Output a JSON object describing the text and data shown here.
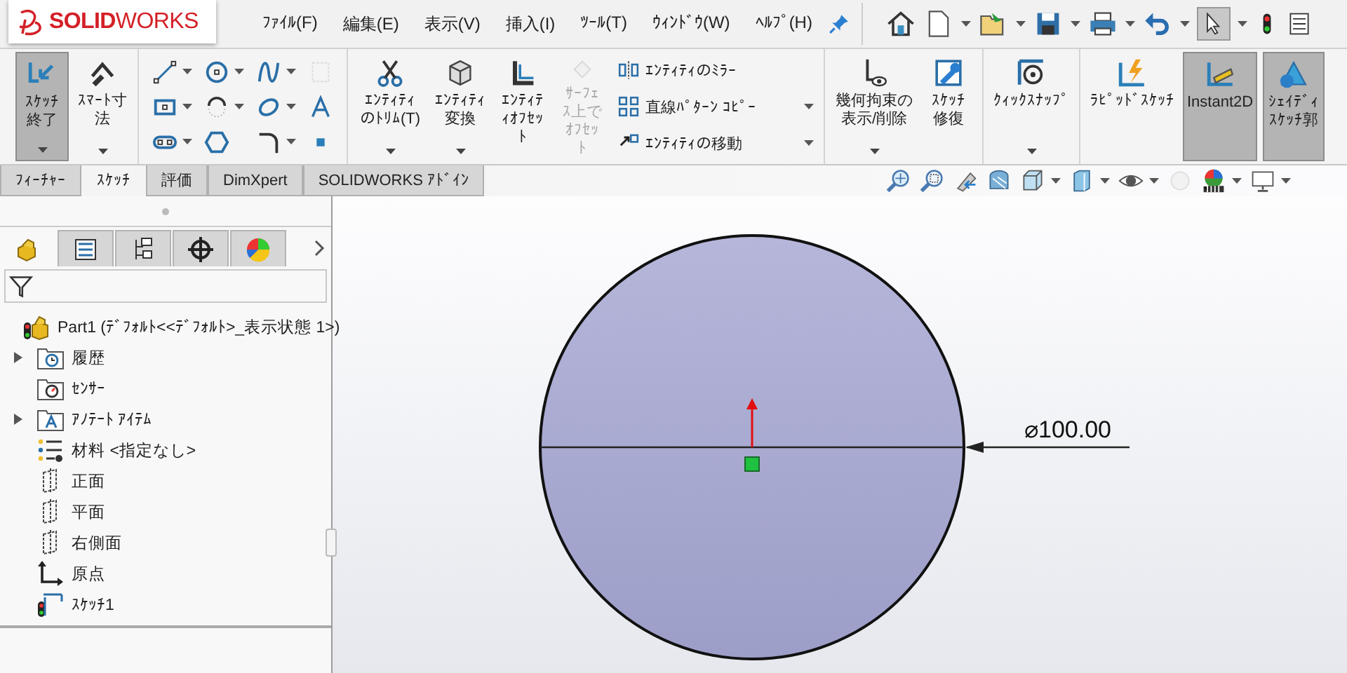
{
  "title_bar": {
    "logo": "**SOLID**WORKS"
  },
  "menu": [
    {
      "label": "ﾌｧｲﾙ(F)"
    },
    {
      "label": "編集(E)"
    },
    {
      "label": "表示(V)"
    },
    {
      "label": "挿入(I)"
    },
    {
      "label": "ﾂｰﾙ(T)"
    },
    {
      "label": "ｳｨﾝﾄﾞｳ(W)"
    },
    {
      "label": "ﾍﾙﾌﾟ(H)"
    }
  ],
  "ribbon_groups": [
    {
      "items": [
        {
          "kind": "large",
          "label": "ｽｹｯﾁ終了",
          "selected": true,
          "disabled": false,
          "dropdown": true
        },
        {
          "kind": "large",
          "label": "ｽﾏｰﾄ寸法",
          "selected": false,
          "disabled": false,
          "dropdown": true
        }
      ]
    },
    {
      "items": [
        {
          "kind": "grid"
        }
      ]
    },
    {
      "items": [
        {
          "kind": "large",
          "label": "ｴﾝﾃｨﾃｨのﾄﾘﾑ(T)",
          "selected": false,
          "disabled": false,
          "dropdown": true
        },
        {
          "kind": "large",
          "label": "ｴﾝﾃｨﾃｨ変換",
          "selected": false,
          "disabled": false,
          "dropdown": true
        },
        {
          "kind": "large",
          "label": "ｴﾝﾃｨﾃｨｵﾌｾｯﾄ",
          "selected": false,
          "disabled": false,
          "dropdown": false
        },
        {
          "kind": "large",
          "label": "ｻｰﾌｪｽ上でｵﾌｾｯﾄ",
          "selected": false,
          "disabled": true,
          "dropdown": false
        },
        {
          "kind": "list",
          "entries": [
            {
              "label": "ｴﾝﾃｨﾃｨのﾐﾗｰ",
              "dropdown": false
            },
            {
              "label": "直線ﾊﾟﾀｰﾝ ｺﾋﾟｰ",
              "dropdown": true
            },
            {
              "label": "ｴﾝﾃｨﾃｨの移動",
              "dropdown": true
            }
          ]
        }
      ]
    },
    {
      "items": [
        {
          "kind": "large",
          "label": "幾何拘束の表示/削除",
          "selected": false,
          "disabled": false,
          "dropdown": true
        },
        {
          "kind": "large",
          "label": "ｽｹｯﾁ修復",
          "selected": false,
          "disabled": false,
          "dropdown": false
        }
      ]
    },
    {
      "items": [
        {
          "kind": "large",
          "label": "ｸｨｯｸｽﾅｯﾌﾟ",
          "selected": false,
          "disabled": false,
          "dropdown": true
        }
      ]
    },
    {
      "items": [
        {
          "kind": "large",
          "label": "ﾗﾋﾟｯﾄﾞｽｹｯﾁ",
          "selected": false,
          "disabled": false,
          "dropdown": false
        },
        {
          "kind": "large",
          "label": "Instant2D",
          "selected": true,
          "disabled": false,
          "dropdown": false
        },
        {
          "kind": "large",
          "label": "ｼｪｲﾃﾞｨｽｹｯﾁ郭",
          "selected": true,
          "disabled": false,
          "dropdown": false
        }
      ]
    }
  ],
  "tabs": [
    {
      "label": "ﾌｨｰﾁｬｰ",
      "selected": false
    },
    {
      "label": "ｽｹｯﾁ",
      "selected": true
    },
    {
      "label": "評価",
      "selected": false
    },
    {
      "label": "DimXpert",
      "selected": false
    },
    {
      "label": "SOLIDWORKS ｱﾄﾞｲﾝ",
      "selected": false
    }
  ],
  "panel_tabs": [
    {
      "kind": "features",
      "selected": true
    },
    {
      "kind": "properties",
      "selected": false
    },
    {
      "kind": "configurations",
      "selected": false
    },
    {
      "kind": "dimxpert",
      "selected": false
    },
    {
      "kind": "display",
      "selected": false
    }
  ],
  "tree": [
    {
      "kind": "part",
      "label": "Part1 (ﾃﾞﾌｫﾙﾄ<<ﾃﾞﾌｫﾙﾄ>_表示状態 1>)",
      "expandable": false,
      "children": [
        {
          "kind": "history",
          "label": "履歴",
          "expandable": true
        },
        {
          "kind": "sensors",
          "label": "ｾﾝｻｰ",
          "expandable": false
        },
        {
          "kind": "annotations",
          "label": "ｱﾉﾃｰﾄ ｱｲﾃﾑ",
          "expandable": true
        },
        {
          "kind": "material",
          "label": "材料 <指定なし>",
          "expandable": false
        },
        {
          "kind": "plane",
          "label": "正面",
          "expandable": false
        },
        {
          "kind": "plane",
          "label": "平面",
          "expandable": false
        },
        {
          "kind": "plane",
          "label": "右側面",
          "expandable": false
        },
        {
          "kind": "origin",
          "label": "原点",
          "expandable": false
        },
        {
          "kind": "sketch",
          "label": "ｽｹｯﾁ1",
          "expandable": false
        }
      ]
    }
  ],
  "viewport": {
    "dimension": "⌀100.00"
  }
}
